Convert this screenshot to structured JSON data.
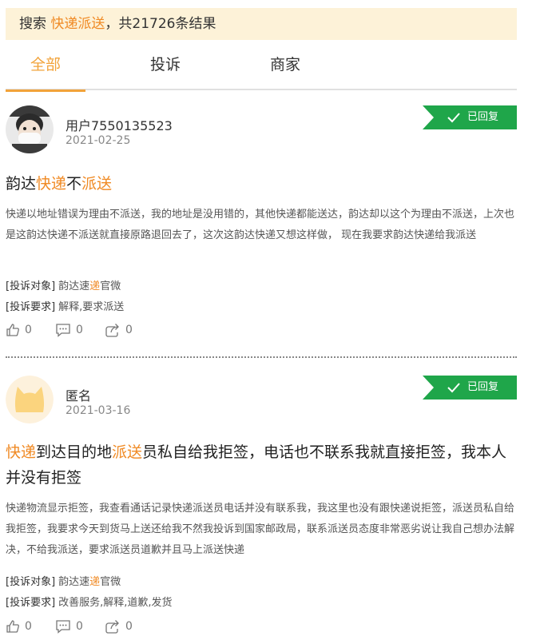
{
  "search": {
    "prefix": "搜索 ",
    "keyword": "快递派送",
    "suffix": "，共21726条结果"
  },
  "tabs": [
    {
      "label": "全部",
      "active": true
    },
    {
      "label": "投诉",
      "active": false
    },
    {
      "label": "商家",
      "active": false
    }
  ],
  "colors": {
    "accent": "#f2a33a",
    "highlight": "#f08a24",
    "badge": "#1fa64a",
    "banner": "#fdf2d8"
  },
  "posts": [
    {
      "user": "用户7550135523",
      "date": "2021-02-25",
      "avatar_icon": "child-with-mask-photo",
      "badge": "已回复",
      "title": {
        "a": "韵达",
        "b": "快递",
        "c": "不",
        "d": "派送",
        "e": ""
      },
      "description": "快递以地址错误为理由不派送，我的地址是没用错的，其他快递都能送达，韵达却以这个为理由不派送，上次也是这韵达快递不派送就直接原路退回去了，这次这韵达快递又想这样做， 现在我要求韵达快递给我派送",
      "target_label": "[投诉对象]",
      "target": {
        "a": "韵达速",
        "b": "递",
        "c": "官微"
      },
      "request_label": "[投诉要求]",
      "request": "解释,要求派送",
      "likes": "0",
      "comments": "0",
      "shares": "0"
    },
    {
      "user": "匿名",
      "date": "2021-03-16",
      "avatar_icon": "anonymous-cat-icon",
      "badge": "已回复",
      "title": {
        "a": "快递",
        "b": "到达目的地",
        "c": "派送",
        "d": "员私自给我拒签，电话也不联系我就直接拒签，我本人并没有拒签"
      },
      "description": "快递物流显示拒签，我查看通话记录快递派送员电话并没有联系我，我这里也没有跟快递说拒签，派送员私自给我拒签，我要求今天到货马上送还给我不然我投诉到国家邮政局，联系派送员态度非常恶劣说让我自己想办法解决，不给我派送，要求派送员道歉并且马上派送快递",
      "target_label": "[投诉对象]",
      "target": {
        "a": "韵达速",
        "b": "递",
        "c": "官微"
      },
      "request_label": "[投诉要求]",
      "request": "改善服务,解释,道歉,发货",
      "likes": "0",
      "comments": "0",
      "shares": "0"
    }
  ]
}
